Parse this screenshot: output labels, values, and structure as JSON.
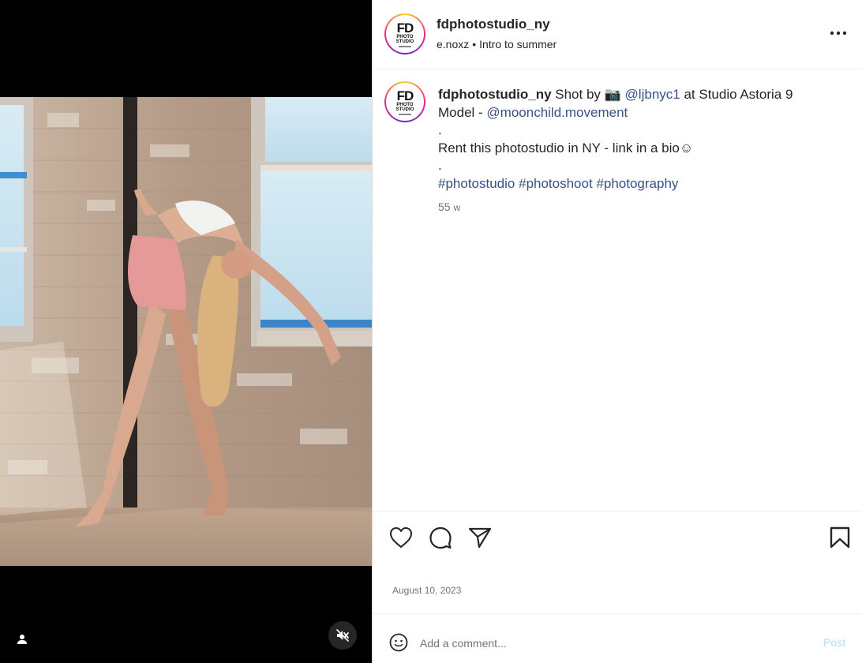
{
  "post": {
    "author": "fdphotostudio_ny",
    "avatar_logo": {
      "main": "FD",
      "line1": "PHOTO",
      "line2": "STUDIO"
    },
    "audio_artist": "e.noxz",
    "audio_separator": "•",
    "audio_track": "Intro to summer",
    "more_icon": "more-horizontal-icon"
  },
  "caption": {
    "author": "fdphotostudio_ny",
    "text_1": " Shot by ",
    "camera_emoji": "📷",
    "mention_1": "@ljbnyc1",
    "text_2": " at Studio Astoria 9",
    "text_3": "Model - ",
    "mention_2": "@moonchild.movement",
    "dot_1": ".",
    "line_rent": "Rent this photostudio in NY - link in a bio",
    "smile": "☺",
    "dot_2": ".",
    "hashtag_1": "#photostudio",
    "hashtag_2": "#photoshoot",
    "hashtag_3": "#photography",
    "age_value": "55",
    "age_unit": "w"
  },
  "actions": {
    "icons": [
      "heart-icon",
      "comment-icon",
      "share-icon",
      "bookmark-icon"
    ],
    "date": "August 10, 2023"
  },
  "comment_box": {
    "placeholder": "Add a comment...",
    "post_label": "Post",
    "post_color": "#b2dffc"
  },
  "media": {
    "tag_icon": "user-tag-icon",
    "mute_icon": "muted-speaker-icon"
  },
  "colors": {
    "link": "#385185",
    "text": "#262626",
    "muted": "#737373",
    "media_bg": "#000000"
  }
}
